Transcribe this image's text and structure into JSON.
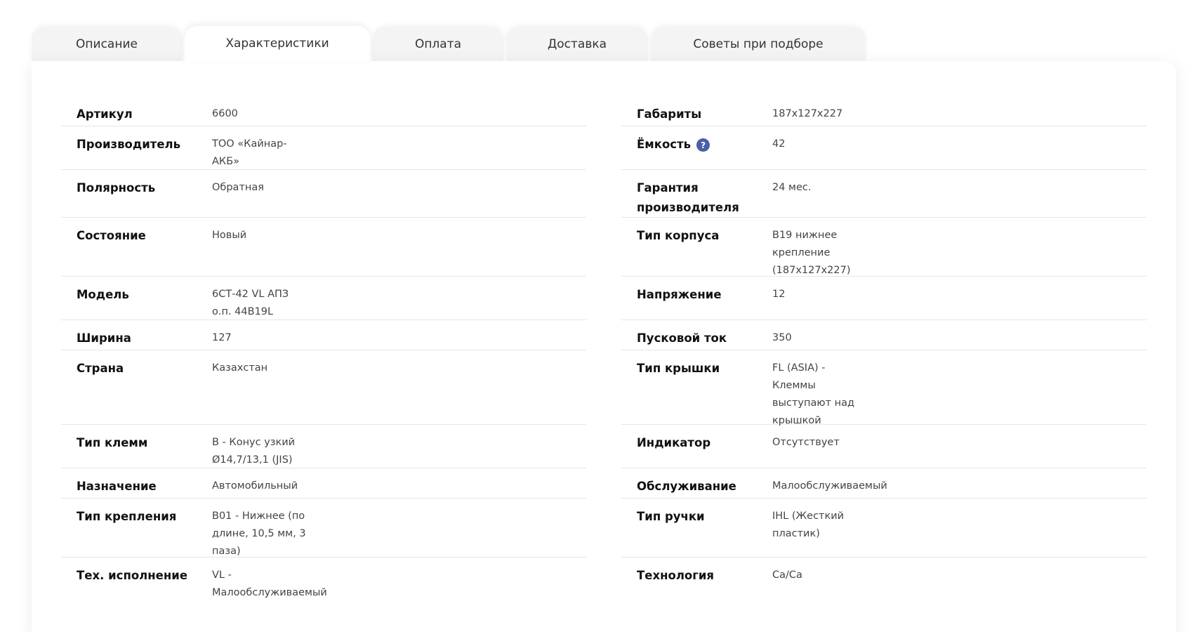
{
  "tabs": [
    {
      "label": "Описание"
    },
    {
      "label": "Характеристики"
    },
    {
      "label": "Оплата"
    },
    {
      "label": "Доставка"
    },
    {
      "label": "Советы при подборе"
    }
  ],
  "specs_left": [
    {
      "label": "Артикул",
      "value": "6600"
    },
    {
      "label": "Производитель",
      "value": "ТОО «Кайнар-\nАКБ»"
    },
    {
      "label": "Полярность",
      "value": "Обратная"
    },
    {
      "label": "Состояние",
      "value": "Новый"
    },
    {
      "label": "Модель",
      "value": "6СТ-42 VL АПЗ\nо.п. 44B19L"
    },
    {
      "label": "Ширина",
      "value": "127"
    },
    {
      "label": "Страна",
      "value": "Казахстан"
    },
    {
      "label": "Тип клемм",
      "value": "B - Конус узкий\nØ14,7/13,1 (JIS)"
    },
    {
      "label": "Назначение",
      "value": "Автомобильный"
    },
    {
      "label": "Тип крепления",
      "value": "B01 - Нижнее (по\nдлине, 10,5 мм, 3\nпаза)"
    },
    {
      "label": "Тех. исполнение",
      "value": "VL -\nМалообслуживаемый"
    }
  ],
  "specs_right": [
    {
      "label": "Габариты",
      "value": "187x127x227"
    },
    {
      "label": "Ёмкость",
      "value": "42",
      "help": "?"
    },
    {
      "label": "Гарантия\nпроизводителя",
      "value": "24 мес."
    },
    {
      "label": "Тип корпуса",
      "value": "B19 нижнее\nкрепление\n(187x127x227)"
    },
    {
      "label": "Напряжение",
      "value": "12"
    },
    {
      "label": "Пусковой ток",
      "value": "350"
    },
    {
      "label": "Тип крышки",
      "value": "FL (ASIA) -\nКлеммы\nвыступают над\nкрышкой"
    },
    {
      "label": "Индикатор",
      "value": "Отсутствует"
    },
    {
      "label": "Обслуживание",
      "value": "Малообслуживаемый"
    },
    {
      "label": "Тип ручки",
      "value": "IHL (Жесткий\nпластик)"
    },
    {
      "label": "Технология",
      "value": "Ca/Ca"
    }
  ]
}
